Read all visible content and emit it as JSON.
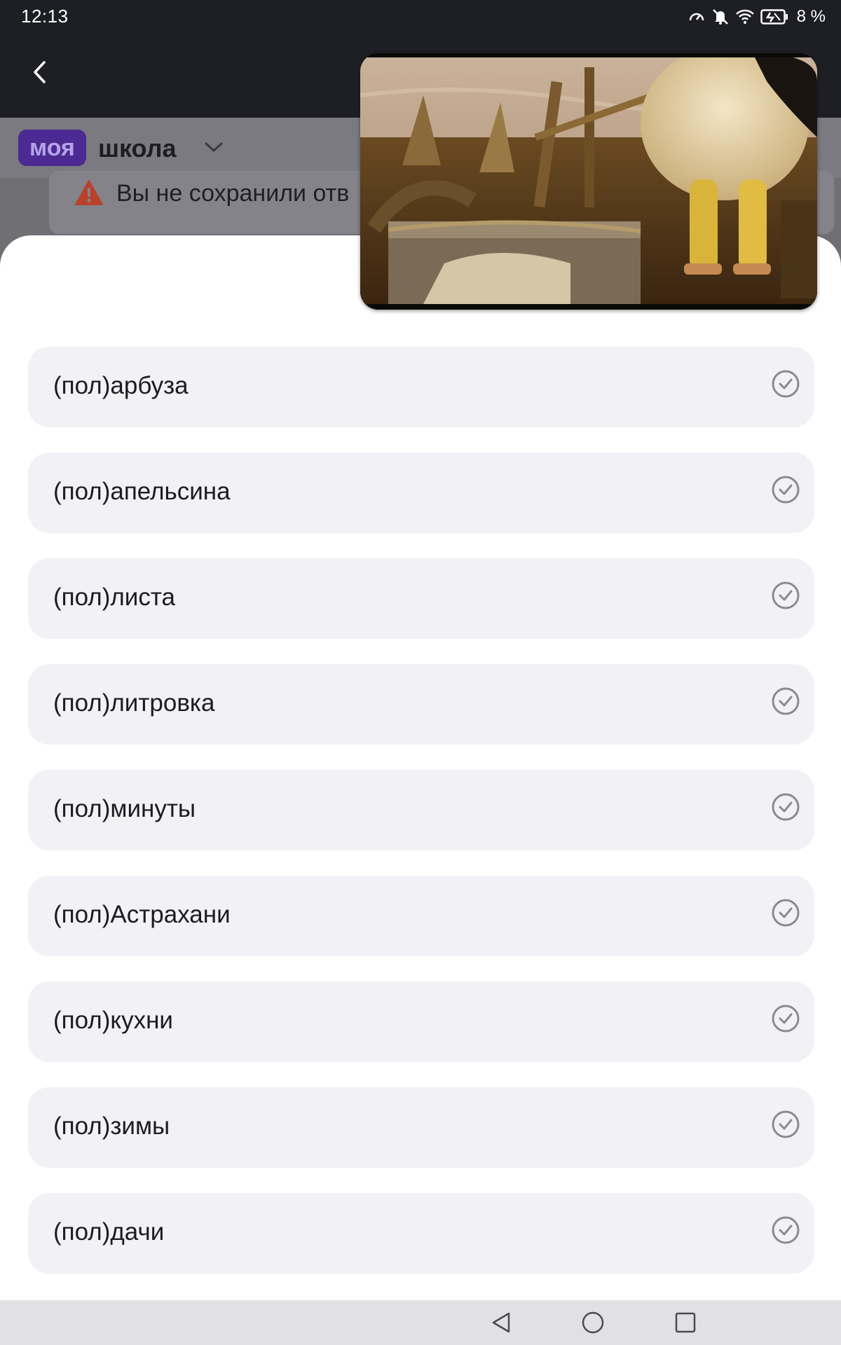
{
  "status_bar": {
    "time": "12:13",
    "battery_percent": "8 %",
    "icons": [
      "speedometer-icon",
      "bell-off-icon",
      "wifi-icon",
      "battery-charging-icon"
    ]
  },
  "top_bar": {
    "back_icon": "chevron-left-icon"
  },
  "header": {
    "logo_badge": "моя",
    "logo_text": "школа",
    "dropdown_icon": "chevron-down-icon"
  },
  "warning": {
    "icon": "warning-triangle-icon",
    "text": "Вы не сохранили отв"
  },
  "options": [
    {
      "label": "(пол)арбуза"
    },
    {
      "label": "(пол)апельсина"
    },
    {
      "label": "(пол)листа"
    },
    {
      "label": "(пол)литровка"
    },
    {
      "label": "(пол)минуты"
    },
    {
      "label": "(пол)Астрахани"
    },
    {
      "label": "(пол)кухни"
    },
    {
      "label": "(пол)зимы"
    },
    {
      "label": "(пол)дачи"
    }
  ],
  "pip_video": {
    "description_icon": "video-thumbnail"
  },
  "nav_bar": {
    "icons": [
      "nav-back-icon",
      "nav-home-icon",
      "nav-recents-icon"
    ]
  },
  "colors": {
    "dark_bar": "#1e1f25",
    "brand_purple": "#4b2a93",
    "option_bg": "#f2f2f6",
    "warning_red": "#b9412a",
    "check_gray": "#8a8a90"
  }
}
